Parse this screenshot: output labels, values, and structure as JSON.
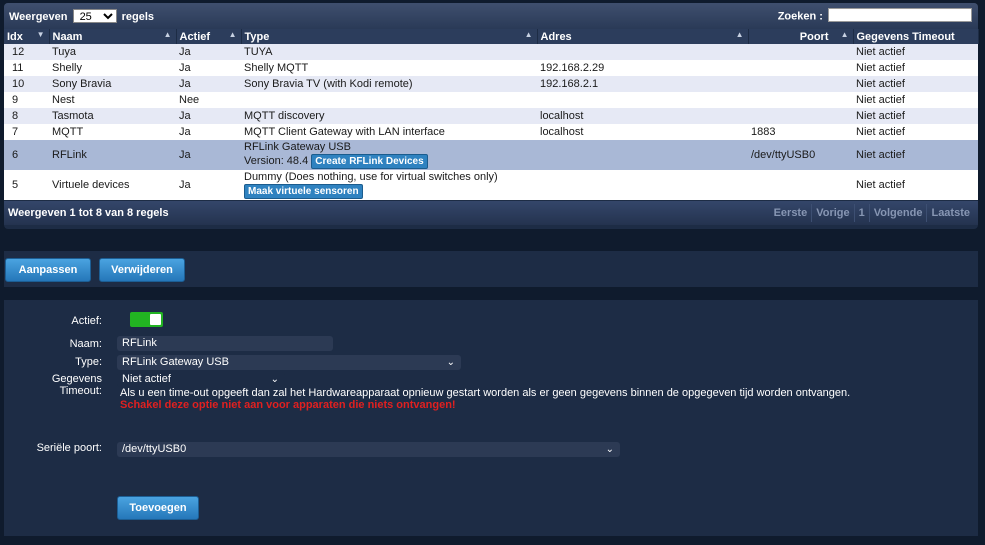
{
  "table": {
    "show_label": "Weergeven",
    "page_length": "25",
    "rows_label": "regels",
    "search_label": "Zoeken :",
    "search_value": "",
    "columns": [
      "Idx",
      "Naam",
      "Actief",
      "Type",
      "Adres",
      "Poort",
      "Gegevens Timeout"
    ],
    "rows": [
      {
        "idx": "12",
        "naam": "Tuya",
        "actief": "Ja",
        "type": "TUYA",
        "type2": "",
        "btn": "",
        "adres": "",
        "poort": "",
        "timeout": "Niet actief"
      },
      {
        "idx": "11",
        "naam": "Shelly",
        "actief": "Ja",
        "type": "Shelly MQTT",
        "type2": "",
        "btn": "",
        "adres": "192.168.2.29",
        "poort": "",
        "timeout": "Niet actief"
      },
      {
        "idx": "10",
        "naam": "Sony Bravia",
        "actief": "Ja",
        "type": "Sony Bravia TV (with Kodi remote)",
        "type2": "",
        "btn": "",
        "adres": "192.168.2.1",
        "poort": "",
        "timeout": "Niet actief"
      },
      {
        "idx": "9",
        "naam": "Nest",
        "actief": "Nee",
        "type": "",
        "type2": "",
        "btn": "",
        "adres": "",
        "poort": "",
        "timeout": "Niet actief"
      },
      {
        "idx": "8",
        "naam": "Tasmota",
        "actief": "Ja",
        "type": "MQTT discovery",
        "type2": "",
        "btn": "",
        "adres": "localhost",
        "poort": "",
        "timeout": "Niet actief"
      },
      {
        "idx": "7",
        "naam": "MQTT",
        "actief": "Ja",
        "type": "MQTT Client Gateway with LAN interface",
        "type2": "",
        "btn": "",
        "adres": "localhost",
        "poort": "1883",
        "timeout": "Niet actief"
      },
      {
        "idx": "6",
        "naam": "RFLink",
        "actief": "Ja",
        "type": "RFLink Gateway USB",
        "type2": "Version: 48.4",
        "btn": "Create RFLink Devices",
        "adres": "",
        "poort": "/dev/ttyUSB0",
        "timeout": "Niet actief"
      },
      {
        "idx": "5",
        "naam": "Virtuele devices",
        "actief": "Ja",
        "type": "Dummy (Does nothing, use for virtual switches only)",
        "type2": "",
        "btn": "Maak virtuele sensoren",
        "adres": "",
        "poort": "",
        "timeout": "Niet actief"
      }
    ],
    "info": "Weergeven 1 tot 8 van 8 regels",
    "pager": {
      "first": "Eerste",
      "prev": "Vorige",
      "page": "1",
      "next": "Volgende",
      "last": "Laatste"
    }
  },
  "actions": {
    "update": "Aanpassen",
    "delete": "Verwijderen"
  },
  "form": {
    "active_label": "Actief:",
    "active_value": true,
    "name_label": "Naam:",
    "name_value": "RFLink",
    "type_label": "Type:",
    "type_value": "RFLink Gateway USB",
    "timeout_label_1": "Gegevens",
    "timeout_label_2": "Timeout:",
    "timeout_value": "Niet actief",
    "timeout_help": "Als u een time-out opgeeft dan zal het Hardwareapparaat opnieuw gestart worden als er geen gegevens binnen de opgegeven tijd worden ontvangen.",
    "timeout_warning": "Schakel deze optie niet aan voor apparaten die niets ontvangen!",
    "serial_label": "Seriële poort:",
    "serial_value": "/dev/ttyUSB0",
    "add_button": "Toevoegen"
  },
  "colors": {
    "accent": "#2f82c0",
    "toggle_on": "#22b422",
    "warning": "#e02020",
    "panel": "#1d2c45"
  }
}
